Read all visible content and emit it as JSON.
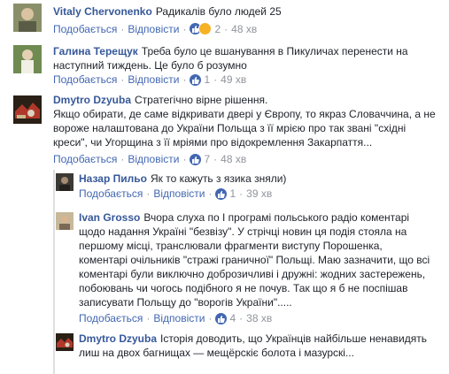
{
  "actions": {
    "like": "Подобається",
    "reply": "Відповісти",
    "sep": "·"
  },
  "comments": [
    {
      "author": "Vitaly Chervonenko",
      "text": "Радикалів було людей 25",
      "count": "2",
      "time": "48 хв"
    },
    {
      "author": "Галина Терещук",
      "text": "Треба було це вшанування в Пикуличах перенести на наступний тиждень. Це було б розумно",
      "count": "1",
      "time": "49 хв"
    },
    {
      "author": "Dmytro Dzyuba",
      "text": "Стратегічно вірне рішення.",
      "text2": "Якщо обирати, де саме відкривати двері у Європу, то якраз Словаччина, а не вороже налаштована до України Польща з її мрією про так звані \"східні креси\", чи Угорщина з її мріями про відокремлення Закарпаття...",
      "count": "7",
      "time": "48 хв"
    },
    {
      "author": "Назар Пильо",
      "text": "Як то кажуть з язика зняли)",
      "count": "1",
      "time": "39 хв"
    },
    {
      "author": "Ivan Grosso",
      "text": "Вчора слуха по I програмі польського радіо коментарі щодо надання Україні \"безвізу\". У стрічці новин ця подія стояла на першому місці, транслювали фрагменти виступу Порошенка, коментарі очільників \"стражі граничної\" Польщі. Маю зазначити, що всі коментарі були виключно доброзичливі і дружні: жодних застережень, побоювань чи чогось подібного я не почув. Так що я б не поспішав записувати Польщу до \"ворогів України\".....",
      "count": "4",
      "time": "38 хв"
    },
    {
      "author": "Dmytro Dzyuba",
      "text": "Історія доводить, що Українців найбільше ненавидять лиш на двох багнищах — мещёрскіє болота і мазурскі..."
    }
  ],
  "colors": {
    "link": "#365899",
    "action": "#4267b2",
    "meta": "#90949c",
    "text": "#1d2129"
  }
}
